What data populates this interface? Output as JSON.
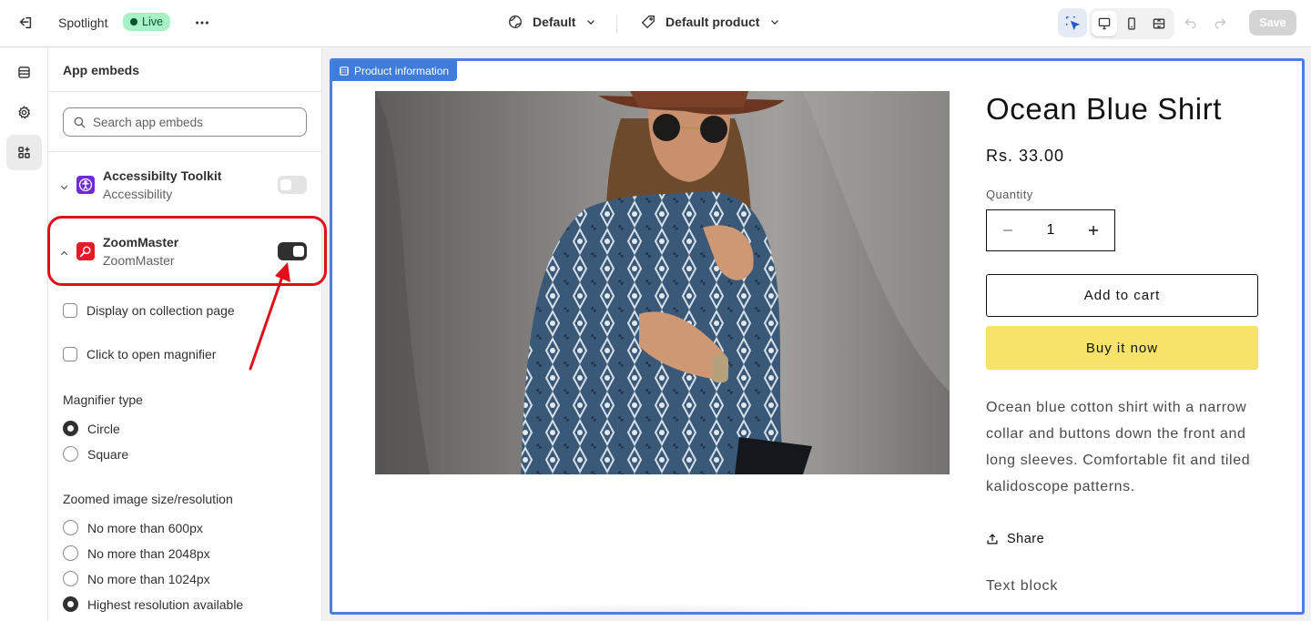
{
  "topbar": {
    "store_name": "Spotlight",
    "live_label": "Live",
    "theme_dropdown": "Default",
    "template_dropdown": "Default product",
    "save_label": "Save"
  },
  "panel": {
    "title": "App embeds",
    "search_placeholder": "Search app embeds",
    "embeds": [
      {
        "name": "Accessibilty Toolkit",
        "subtitle": "Accessibility",
        "enabled": false,
        "expanded": false
      },
      {
        "name": "ZoomMaster",
        "subtitle": "ZoomMaster",
        "enabled": true,
        "expanded": true
      }
    ],
    "settings": {
      "display_on_collection": "Display on collection page",
      "click_to_open": "Click to open magnifier",
      "magnifier_type_label": "Magnifier type",
      "magnifier_types": [
        "Circle",
        "Square"
      ],
      "magnifier_type_selected": "Circle",
      "zoom_size_label": "Zoomed image size/resolution",
      "zoom_sizes": [
        "No more than 600px",
        "No more than 2048px",
        "No more than 1024px",
        "Highest resolution available"
      ],
      "zoom_size_selected": "Highest resolution available"
    }
  },
  "preview": {
    "section_tag": "Product information",
    "product": {
      "title": "Ocean Blue Shirt",
      "price": "Rs. 33.00",
      "quantity_label": "Quantity",
      "quantity": "1",
      "add_to_cart": "Add to cart",
      "buy_now": "Buy it now",
      "description": "Ocean blue cotton shirt with a narrow collar and buttons down the front and long sleeves. Comfortable fit and tiled kalidoscope patterns.",
      "share": "Share",
      "text_block": "Text block"
    }
  },
  "colors": {
    "highlight": "#e0101a",
    "selection_outline": "#4a7fe0",
    "buy_button": "#f7e36a",
    "live_badge": "#a8f0c6"
  }
}
